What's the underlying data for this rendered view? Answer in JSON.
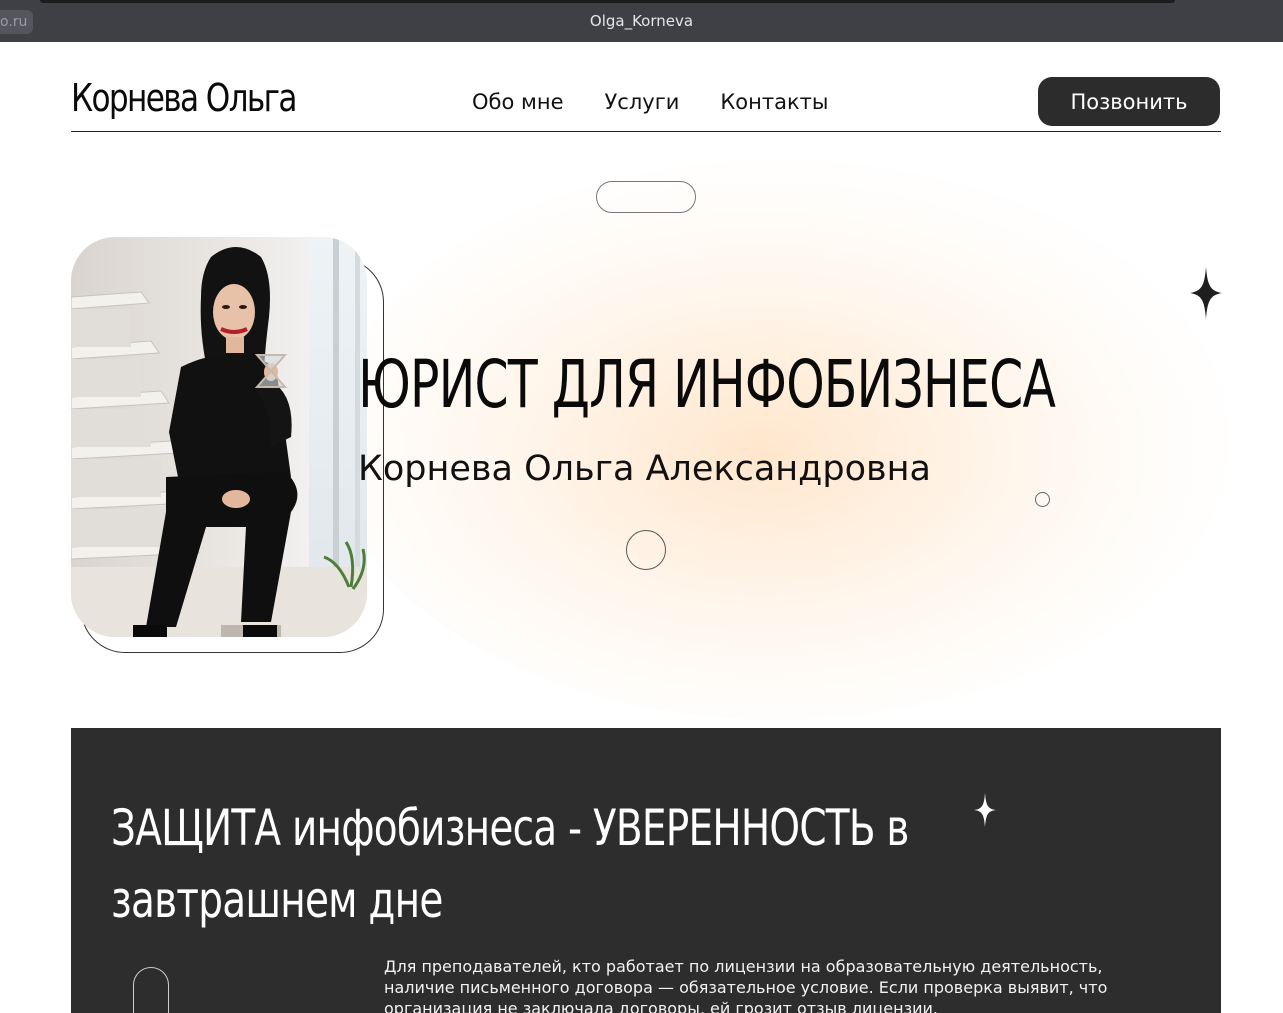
{
  "browser": {
    "url_fragment": "o.ru",
    "window_title": "Olga_Korneva"
  },
  "header": {
    "logo": "Корнева Ольга",
    "nav": [
      "Обо мне",
      "Услуги",
      "Контакты"
    ],
    "call_button": "Позвонить"
  },
  "hero": {
    "title": "ЮРИСТ ДЛЯ ИНФОБИЗНЕСА",
    "subtitle": "Корнева Ольга Александровна"
  },
  "section": {
    "title_line1": "ЗАЩИТА инфобизнеса - УВЕРЕННОСТЬ в",
    "title_line2": "завтрашнем дне",
    "text": "Для преподавателей, кто работает по лицензии на образовательную деятельность, наличие письменного договора — обязательное условие. Если проверка выявит, что организация не заключала договоры, ей грозит отзыв лицензии."
  },
  "colors": {
    "dark_bg": "#2d2d2d",
    "button_bg": "#2c2c2c",
    "glow": "#ffe2c4"
  }
}
